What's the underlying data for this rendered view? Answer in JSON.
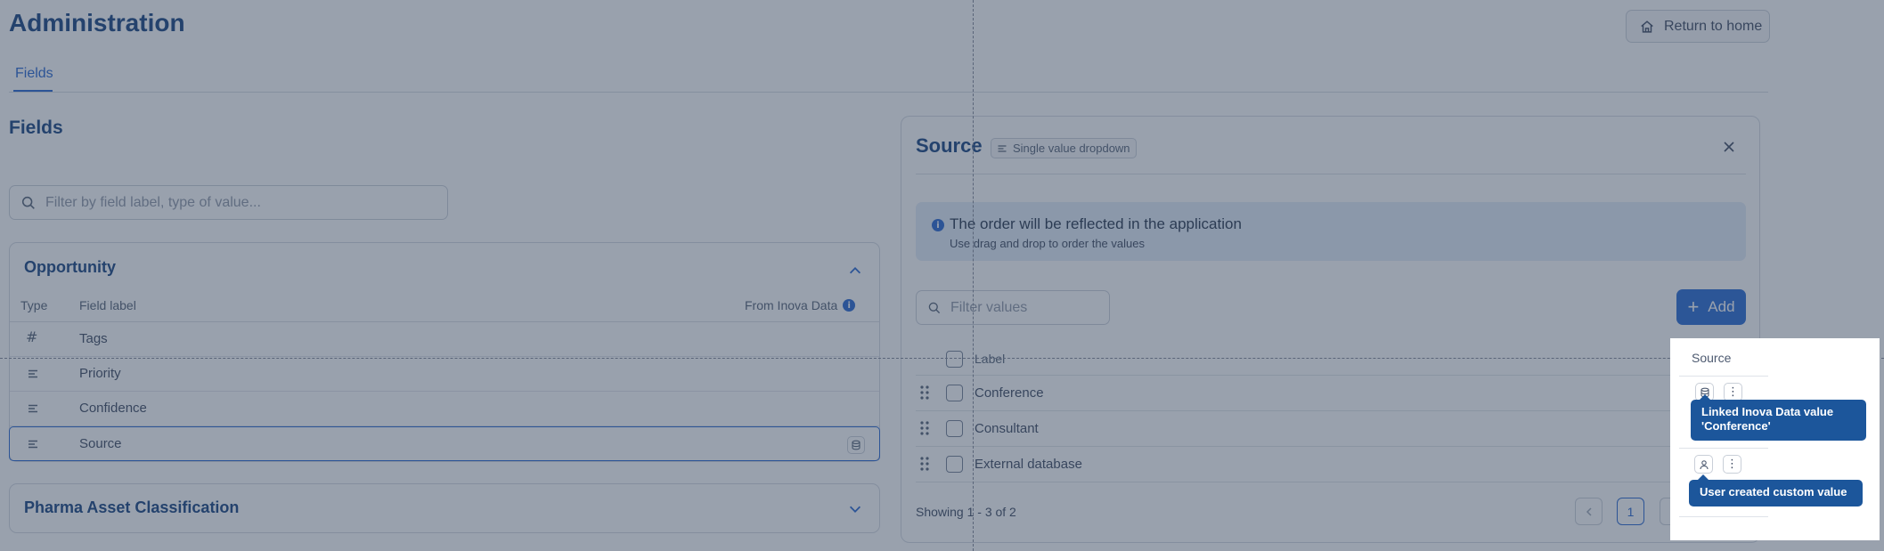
{
  "header": {
    "title": "Administration",
    "return_label": "Return to home"
  },
  "tabs": [
    {
      "label": "Fields",
      "active": true
    }
  ],
  "fields_section": {
    "title": "Fields",
    "filter_placeholder": "Filter by field label, type of value..."
  },
  "groups": [
    {
      "title": "Opportunity",
      "expanded": true,
      "columns": {
        "type": "Type",
        "label": "Field label",
        "from_inova": "From Inova Data"
      },
      "rows": [
        {
          "type_icon": "hash-icon",
          "label": "Tags"
        },
        {
          "type_icon": "lines-icon",
          "label": "Priority"
        },
        {
          "type_icon": "lines-icon",
          "label": "Confidence"
        },
        {
          "type_icon": "lines-icon",
          "label": "Source",
          "selected": true,
          "from_inova": true
        }
      ]
    },
    {
      "title": "Pharma Asset Classification",
      "expanded": false
    }
  ],
  "panel": {
    "title": "Source",
    "type_chip": "Single value dropdown",
    "banner_title": "The order will be reflected in the application",
    "banner_sub": "Use drag and drop to order the values",
    "filter_placeholder": "Filter values",
    "add_label": "Add",
    "columns": {
      "label": "Label",
      "source": "Source"
    },
    "values": [
      {
        "label": "Conference",
        "source_icon": "database-icon"
      },
      {
        "label": "Consultant"
      },
      {
        "label": "External database",
        "source_icon": "user-icon"
      }
    ],
    "pagination": {
      "showing": "Showing 1 - 3 of 2",
      "current_page": "1"
    }
  },
  "tooltips": {
    "linked": "Linked Inova Data value 'Conference'",
    "user_created": "User created custom value"
  },
  "colors": {
    "primary": "#1d62d1",
    "title": "#0b3a7a",
    "tooltip": "#1c569b",
    "overlay": "#3c4a62"
  }
}
